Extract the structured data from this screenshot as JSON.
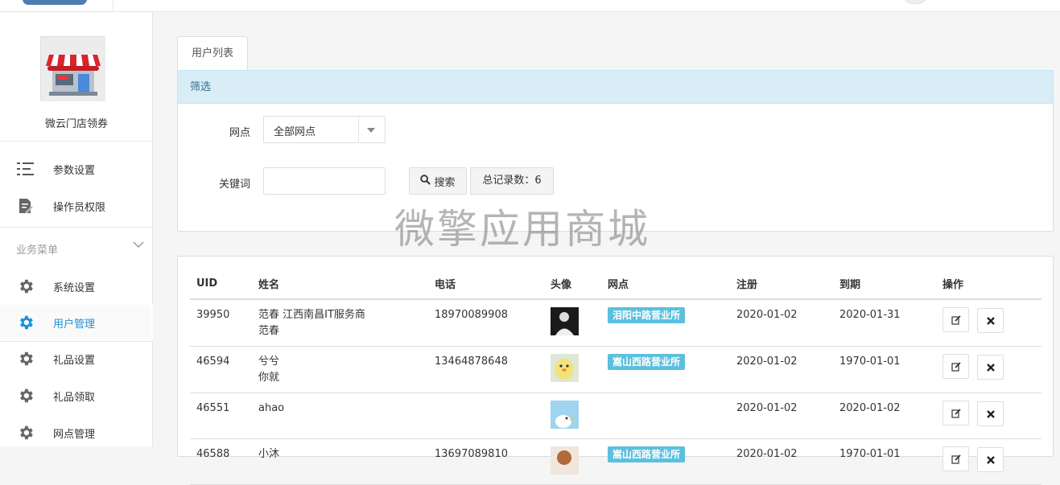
{
  "sidebar": {
    "store_name": "微云门店领券",
    "top_items": [
      {
        "label": "参数设置",
        "icon": "list-settings-icon"
      },
      {
        "label": "操作员权限",
        "icon": "document-edit-icon"
      }
    ],
    "section_label": "业务菜单",
    "biz_items": [
      {
        "label": "系统设置",
        "icon": "gear-icon",
        "active": false
      },
      {
        "label": "用户管理",
        "icon": "gear-icon",
        "active": true
      },
      {
        "label": "礼品设置",
        "icon": "gear-icon",
        "active": false
      },
      {
        "label": "礼品领取",
        "icon": "gear-icon",
        "active": false
      },
      {
        "label": "网点管理",
        "icon": "gear-icon",
        "active": false
      }
    ]
  },
  "main": {
    "tab_label": "用户列表",
    "filter": {
      "title": "筛选",
      "branch_label": "网点",
      "branch_value": "全部网点",
      "keyword_label": "关键词",
      "keyword_value": "",
      "search_label": "搜索",
      "total_label": "总记录数：6"
    },
    "watermark": "微擎应用商城",
    "table": {
      "headers": [
        "UID",
        "姓名",
        "电话",
        "头像",
        "网点",
        "注册",
        "到期",
        "操作"
      ],
      "rows": [
        {
          "uid": "39950",
          "name1": "范春 江西南昌IT服务商",
          "name2": "范春",
          "phone": "18970089908",
          "branch": "泪阳中路营业所",
          "reg": "2020-01-02",
          "exp": "2020-01-31",
          "avatar_color": "#222222"
        },
        {
          "uid": "46594",
          "name1": "兮兮",
          "name2": "你就",
          "phone": "13464878648",
          "branch": "嵩山西路营业所",
          "reg": "2020-01-02",
          "exp": "1970-01-01",
          "avatar_color": "#f2e27a"
        },
        {
          "uid": "46551",
          "name1": "ahao",
          "name2": "",
          "phone": "",
          "branch": "",
          "reg": "2020-01-02",
          "exp": "2020-01-02",
          "avatar_color": "#9fd4ef"
        },
        {
          "uid": "46588",
          "name1": "小沐",
          "name2": "",
          "phone": "13697089810",
          "branch": "嵩山西路营业所",
          "reg": "2020-01-02",
          "exp": "1970-01-01",
          "avatar_color": "#b06a3b"
        }
      ]
    }
  },
  "colors": {
    "accent": "#1e90d6",
    "badge": "#5bc0de",
    "panel_head": "#d9edf7"
  }
}
